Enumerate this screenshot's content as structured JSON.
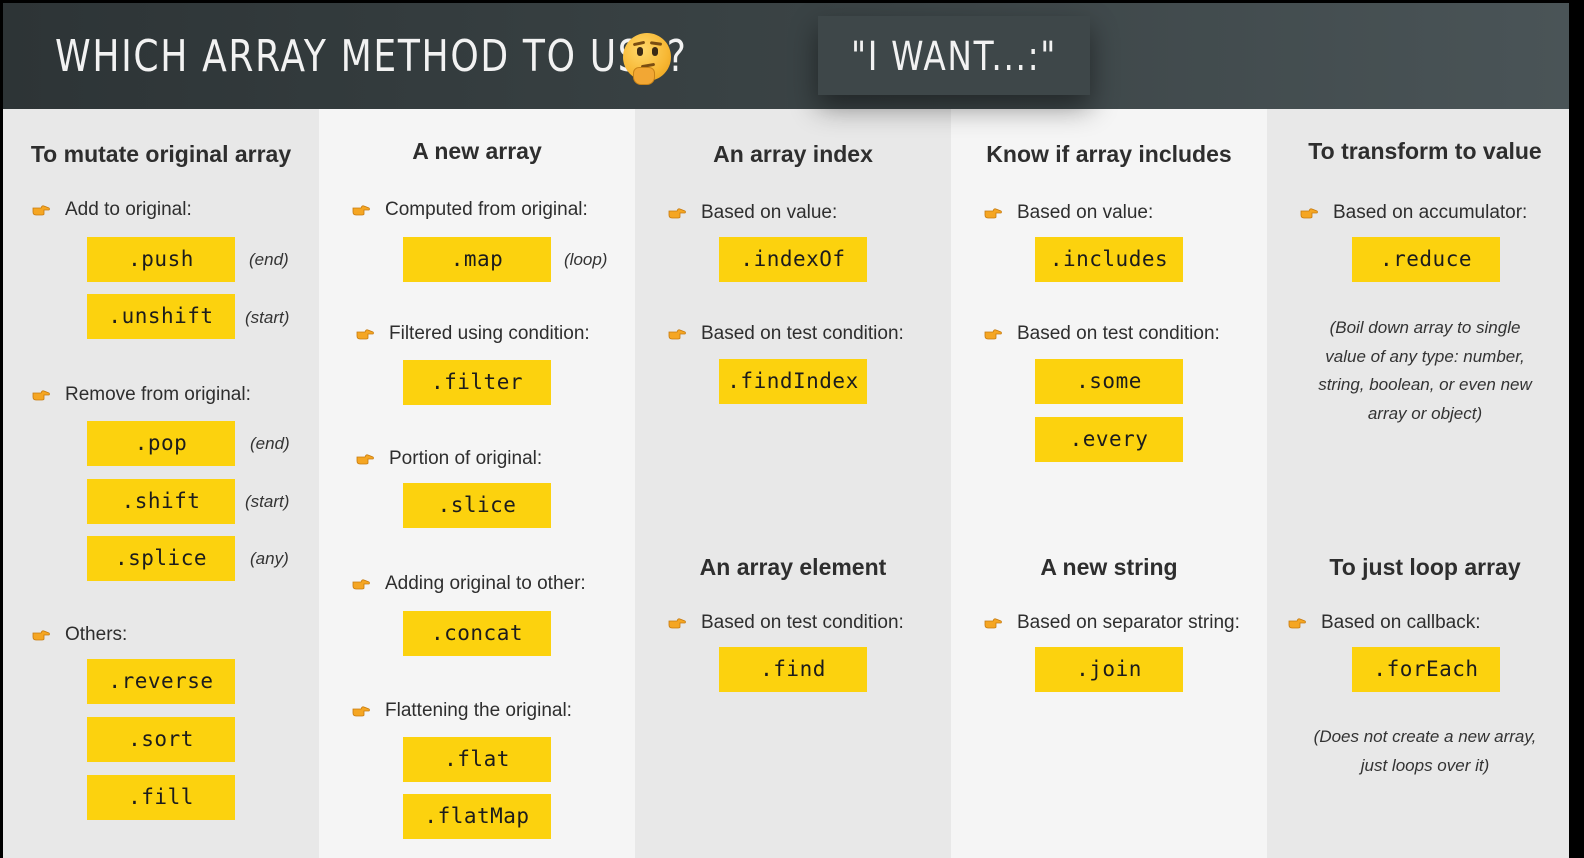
{
  "header": {
    "title": "WHICH ARRAY METHOD TO USE?",
    "want_label": "\"I WANT...:\""
  },
  "colors": {
    "header_bg": "#2d3436",
    "method_bg": "#fcd20e",
    "column_light": "#f5f5f5",
    "column_dark": "#e8e8e8",
    "pointer_icon": "#f5a623"
  },
  "icons": [
    "thinking-face-icon",
    "pointing-hand-icon"
  ],
  "columns": {
    "mutate": {
      "heading": "To mutate original array",
      "add_label": "Add to original:",
      "push": ".push",
      "push_note": "(end)",
      "unshift": ".unshift",
      "unshift_note": "(start)",
      "remove_label": "Remove from original:",
      "pop": ".pop",
      "pop_note": "(end)",
      "shift": ".shift",
      "shift_note": "(start)",
      "splice": ".splice",
      "splice_note": "(any)",
      "others_label": "Others:",
      "reverse": ".reverse",
      "sort": ".sort",
      "fill": ".fill"
    },
    "new_array": {
      "heading": "A new array",
      "computed_label": "Computed from original:",
      "map": ".map",
      "map_note": "(loop)",
      "filtered_label": "Filtered using condition:",
      "filter": ".filter",
      "portion_label": "Portion of original:",
      "slice": ".slice",
      "adding_label": "Adding original to other:",
      "concat": ".concat",
      "flattening_label": "Flattening the original:",
      "flat": ".flat",
      "flatMap": ".flatMap"
    },
    "index": {
      "heading": "An array index",
      "value_label": "Based on value:",
      "indexOf": ".indexOf",
      "test_label": "Based on test condition:",
      "findIndex": ".findIndex",
      "element_heading": "An array element",
      "element_test_label": "Based on test condition:",
      "find": ".find"
    },
    "includes": {
      "heading": "Know if array includes",
      "value_label": "Based on value:",
      "includes": ".includes",
      "test_label": "Based on test condition:",
      "some": ".some",
      "every": ".every",
      "string_heading": "A new string",
      "separator_label": "Based on separator string:",
      "join": ".join"
    },
    "transform": {
      "heading": "To transform to value",
      "accumulator_label": "Based on accumulator:",
      "reduce": ".reduce",
      "reduce_note": [
        "(Boil down array to single",
        "value of any type: number,",
        "string, boolean, or even new",
        "array or object)"
      ],
      "loop_heading": "To just loop array",
      "callback_label": "Based on callback:",
      "forEach": ".forEach",
      "forEach_note": [
        "(Does not create a new array,",
        "just loops over it)"
      ]
    }
  }
}
